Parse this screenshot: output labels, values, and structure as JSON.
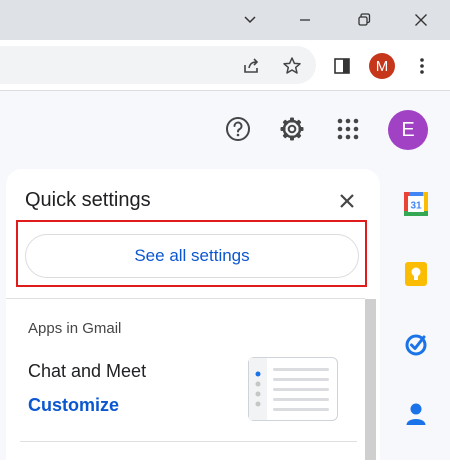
{
  "browser": {
    "profile_initial": "M",
    "colors": {
      "profile": "#c5361b",
      "titlebar": "#dee1e6"
    }
  },
  "gmail_header": {
    "account_initial": "E",
    "colors": {
      "account": "#a142c4"
    }
  },
  "quick_settings": {
    "title": "Quick settings",
    "see_all_label": "See all settings",
    "section_title": "Apps in Gmail",
    "chat_meet_label": "Chat and Meet",
    "customize_label": "Customize"
  },
  "side_panel": {
    "calendar_day": "31"
  },
  "colors": {
    "accent_blue": "#0b57d0",
    "highlight_red": "#e01b1b"
  }
}
